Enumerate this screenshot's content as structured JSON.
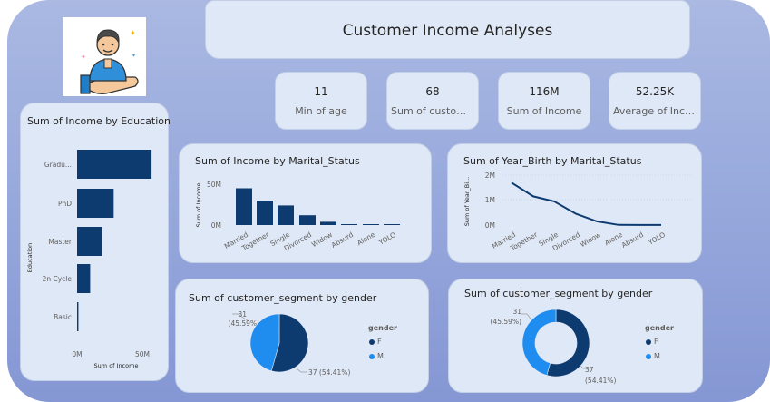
{
  "colors": {
    "primary": "#0d3b70",
    "secondary": "#1f8cf0",
    "card": "#dfe8f6"
  },
  "header": {
    "title": "Customer Income Analyses",
    "logo_icon": "customer-hand-icon"
  },
  "kpis": [
    {
      "value": "11",
      "label": "Min of age"
    },
    {
      "value": "68",
      "label": "Sum of customer_segment"
    },
    {
      "value": "116M",
      "label": "Sum of Income"
    },
    {
      "value": "52.25K",
      "label": "Average of Income"
    }
  ],
  "education_chart": {
    "title": "Sum of Income by Education",
    "categories": [
      "Gradu...",
      "PhD",
      "Master",
      "2n Cycle",
      "Basic"
    ],
    "xticks": [
      "0M",
      "50M"
    ],
    "xlabel": "Sum of Income",
    "ylabel": "Education"
  },
  "marital_income_chart": {
    "title": "Sum of Income by Marital_Status",
    "categories": [
      "Married",
      "Together",
      "Single",
      "Divorced",
      "Widow",
      "Absurd",
      "Alone",
      "YOLO"
    ],
    "yticks": [
      "50M",
      "0M"
    ],
    "ylabel": "Sum of Income"
  },
  "marital_birth_chart": {
    "title": "Sum of Year_Birth by Marital_Status",
    "categories": [
      "Married",
      "Together",
      "Single",
      "Divorced",
      "Widow",
      "Alone",
      "Absurd",
      "YOLO"
    ],
    "yticks": [
      "2M",
      "1M",
      "0M"
    ],
    "ylabel": "Sum of Year_Bi..."
  },
  "pie_chart": {
    "title": "Sum of customer_segment by gender",
    "label_m_value": "31",
    "label_m_pct": "(45.59%)",
    "label_f": "37 (54.41%)",
    "legend_title": "gender",
    "legend": [
      "F",
      "M"
    ]
  },
  "donut_chart": {
    "title": "Sum of customer_segment by gender",
    "label_m_value": "31",
    "label_m_pct": "(45.59%)",
    "label_f_value": "37",
    "label_f_pct": "(54.41%)",
    "legend_title": "gender",
    "legend": [
      "F",
      "M"
    ]
  },
  "chart_data": [
    {
      "type": "bar",
      "orientation": "horizontal",
      "title": "Sum of Income by Education",
      "categories": [
        "Gradu...",
        "PhD",
        "Master",
        "2n Cycle",
        "Basic"
      ],
      "values": [
        57,
        28,
        19,
        10,
        1
      ],
      "xlim": [
        0,
        60
      ],
      "xlabel": "Sum of Income",
      "ylabel": "Education",
      "unit": "M"
    },
    {
      "type": "bar",
      "title": "Sum of Income by Marital_Status",
      "categories": [
        "Married",
        "Together",
        "Single",
        "Divorced",
        "Widow",
        "Absurd",
        "Alone",
        "YOLO"
      ],
      "values": [
        45,
        30,
        24,
        12,
        4,
        0.4,
        0.2,
        0.1
      ],
      "ylim": [
        0,
        55
      ],
      "ylabel": "Sum of Income",
      "unit": "M"
    },
    {
      "type": "line",
      "title": "Sum of Year_Birth by Marital_Status",
      "categories": [
        "Married",
        "Together",
        "Single",
        "Divorced",
        "Widow",
        "Alone",
        "Absurd",
        "YOLO"
      ],
      "values": [
        1.7,
        1.15,
        0.95,
        0.45,
        0.15,
        0.006,
        0.004,
        0.004
      ],
      "ylim": [
        0,
        2
      ],
      "ylabel": "Sum of Year_Bi...",
      "unit": "M"
    },
    {
      "type": "pie",
      "title": "Sum of customer_segment by gender",
      "labels": [
        "F",
        "M"
      ],
      "values": [
        37,
        31
      ],
      "percent": [
        54.41,
        45.59
      ]
    },
    {
      "type": "pie",
      "variant": "donut",
      "title": "Sum of customer_segment by gender",
      "labels": [
        "F",
        "M"
      ],
      "values": [
        37,
        31
      ],
      "percent": [
        54.41,
        45.59
      ]
    }
  ]
}
